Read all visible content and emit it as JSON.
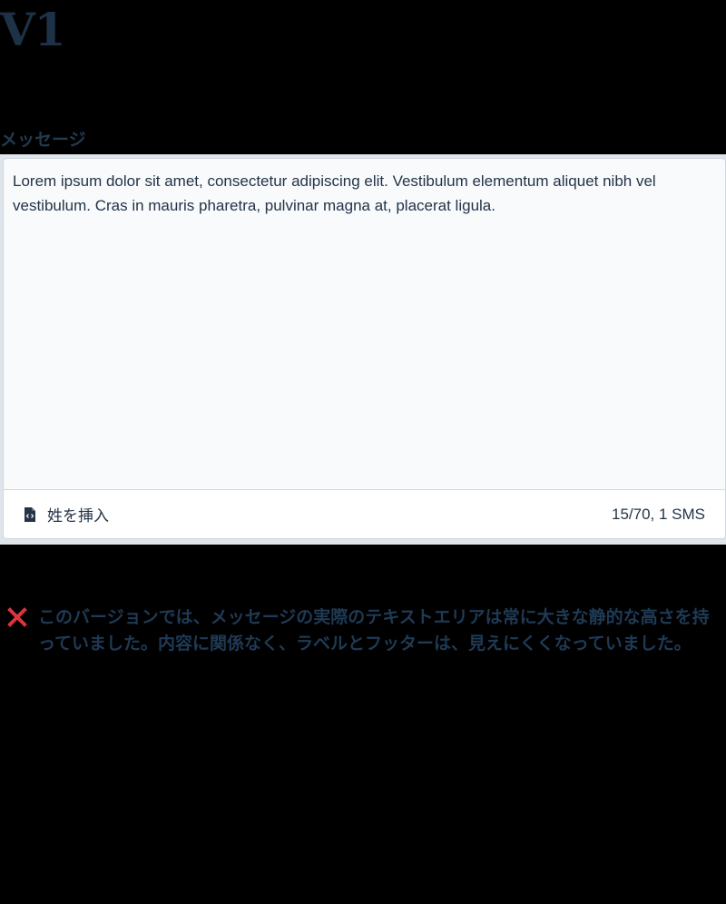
{
  "page": {
    "title": "V1"
  },
  "message_field": {
    "label": "メッセージ",
    "value": "Lorem ipsum dolor sit amet, consectetur adipiscing elit. Vestibulum elementum aliquet nibh vel vestibulum. Cras in mauris pharetra, pulvinar magna at, placerat ligula.",
    "insert_button_label": "姓を挿入",
    "insert_button_icon": "document-code-icon",
    "counter": "15/70, 1 SMS"
  },
  "error": {
    "icon": "close-x-icon",
    "color": "#d9363e",
    "text": "このバージョンでは、メッセージの実際のテキストエリアは常に大きな静的な高さを持っていました。内容に関係なく、ラベルとフッターは、見えにくくなっていました。"
  },
  "colors": {
    "background": "#000000",
    "text_primary": "#1f3a52",
    "field_background": "#f8fafc",
    "footer_background": "#ffffff",
    "error_accent": "#d9363e"
  }
}
